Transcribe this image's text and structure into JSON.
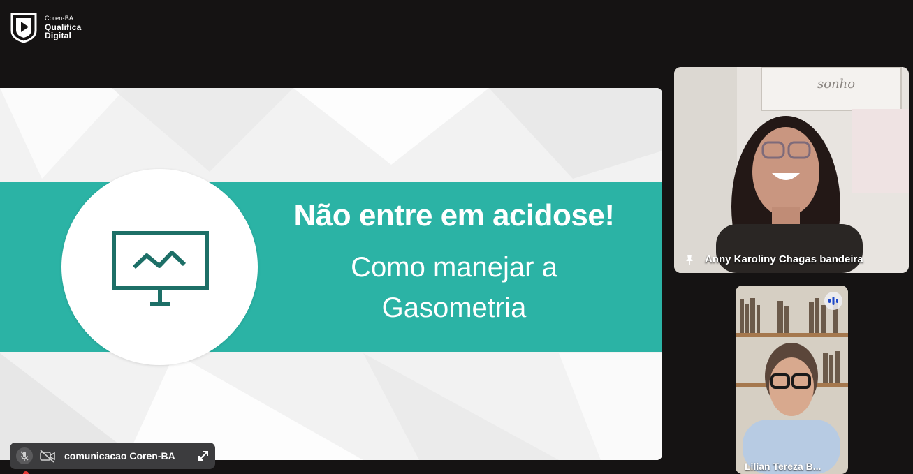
{
  "logo": {
    "org": "Coren-BA",
    "line1": "Qualifica",
    "line2": "Digital",
    "icon": "play-shield-icon"
  },
  "slide": {
    "title": "Não entre em acidose!",
    "subtitle_line1": "Como  manejar a",
    "subtitle_line2": "Gasometria",
    "icon": "presentation-board-icon",
    "accent_color": "#2bb3a5"
  },
  "participants": [
    {
      "name": "Anny Karoliny Chagas bandeira",
      "pinned": true,
      "icon": "pin-icon",
      "wall_sign": "sonho"
    },
    {
      "name": "Lilian Tereza B...",
      "speaking": true,
      "icon": "audio-level-icon"
    }
  ],
  "presenter": {
    "name": "comunicacao Coren-BA",
    "mic_icon": "mic-off-icon",
    "camera_icon": "camera-off-icon",
    "expand_icon": "expand-icon"
  }
}
